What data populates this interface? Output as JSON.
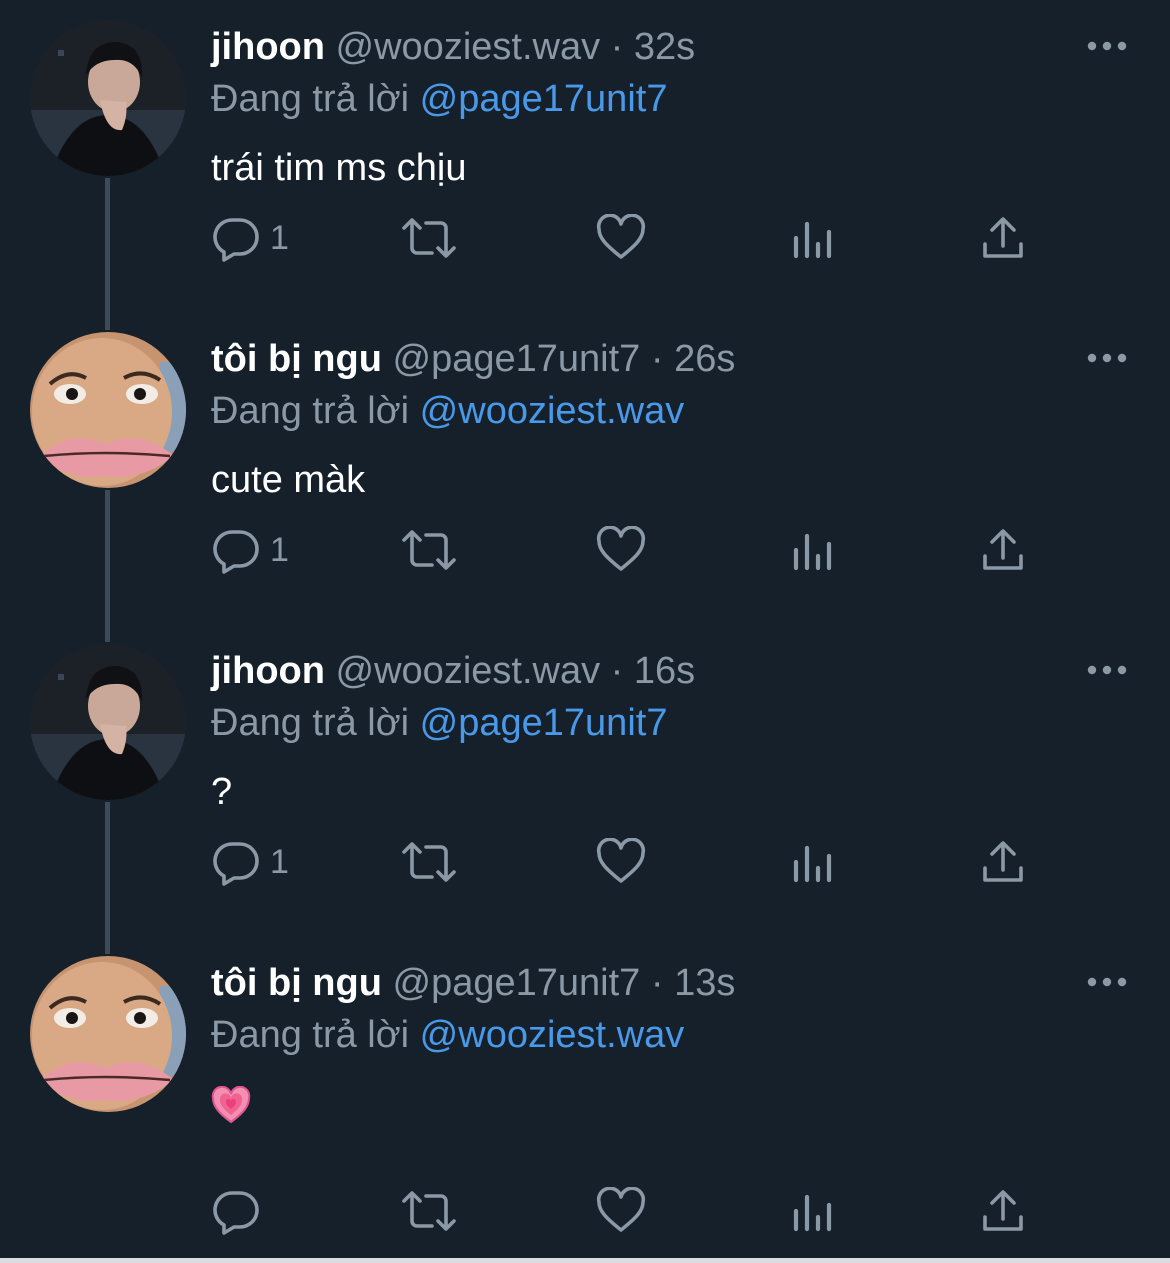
{
  "colors": {
    "background": "#15202b",
    "text_primary": "#ffffff",
    "text_secondary": "#8b98a5",
    "mention": "#4a99e9",
    "thread_line": "#3d4a57",
    "pink_heart": "#f26aa0"
  },
  "tweets": [
    {
      "display_name": "jihoon",
      "meta": "@wooziest.wav · 32s",
      "reply_prefix": "Đang trả lời",
      "reply_handle": "@page17unit7",
      "body": "trái tim ms chịu",
      "reply_count": "1",
      "avatar": "jihoon-avatar"
    },
    {
      "display_name": "tôi bị ngu",
      "meta": "@page17unit7 · 26s",
      "reply_prefix": "Đang trả lời",
      "reply_handle": "@wooziest.wav",
      "body": "cute màk",
      "reply_count": "1",
      "avatar": "meme-face-avatar"
    },
    {
      "display_name": "jihoon",
      "meta": "@wooziest.wav · 16s",
      "reply_prefix": "Đang trả lời",
      "reply_handle": "@page17unit7",
      "body": "?",
      "reply_count": "1",
      "avatar": "jihoon-avatar"
    },
    {
      "display_name": "tôi bị ngu",
      "meta": "@page17unit7 · 13s",
      "reply_prefix": "Đang trả lời",
      "reply_handle": "@wooziest.wav",
      "body": "",
      "body_icon": "growing-pink-heart-icon",
      "reply_count": "",
      "avatar": "meme-face-avatar"
    }
  ],
  "icons": {
    "reply": "reply-bubble-icon",
    "retweet": "retweet-icon",
    "like": "heart-outline-icon",
    "views": "views-chart-icon",
    "share": "share-upload-icon",
    "more": "more-dots-icon"
  }
}
